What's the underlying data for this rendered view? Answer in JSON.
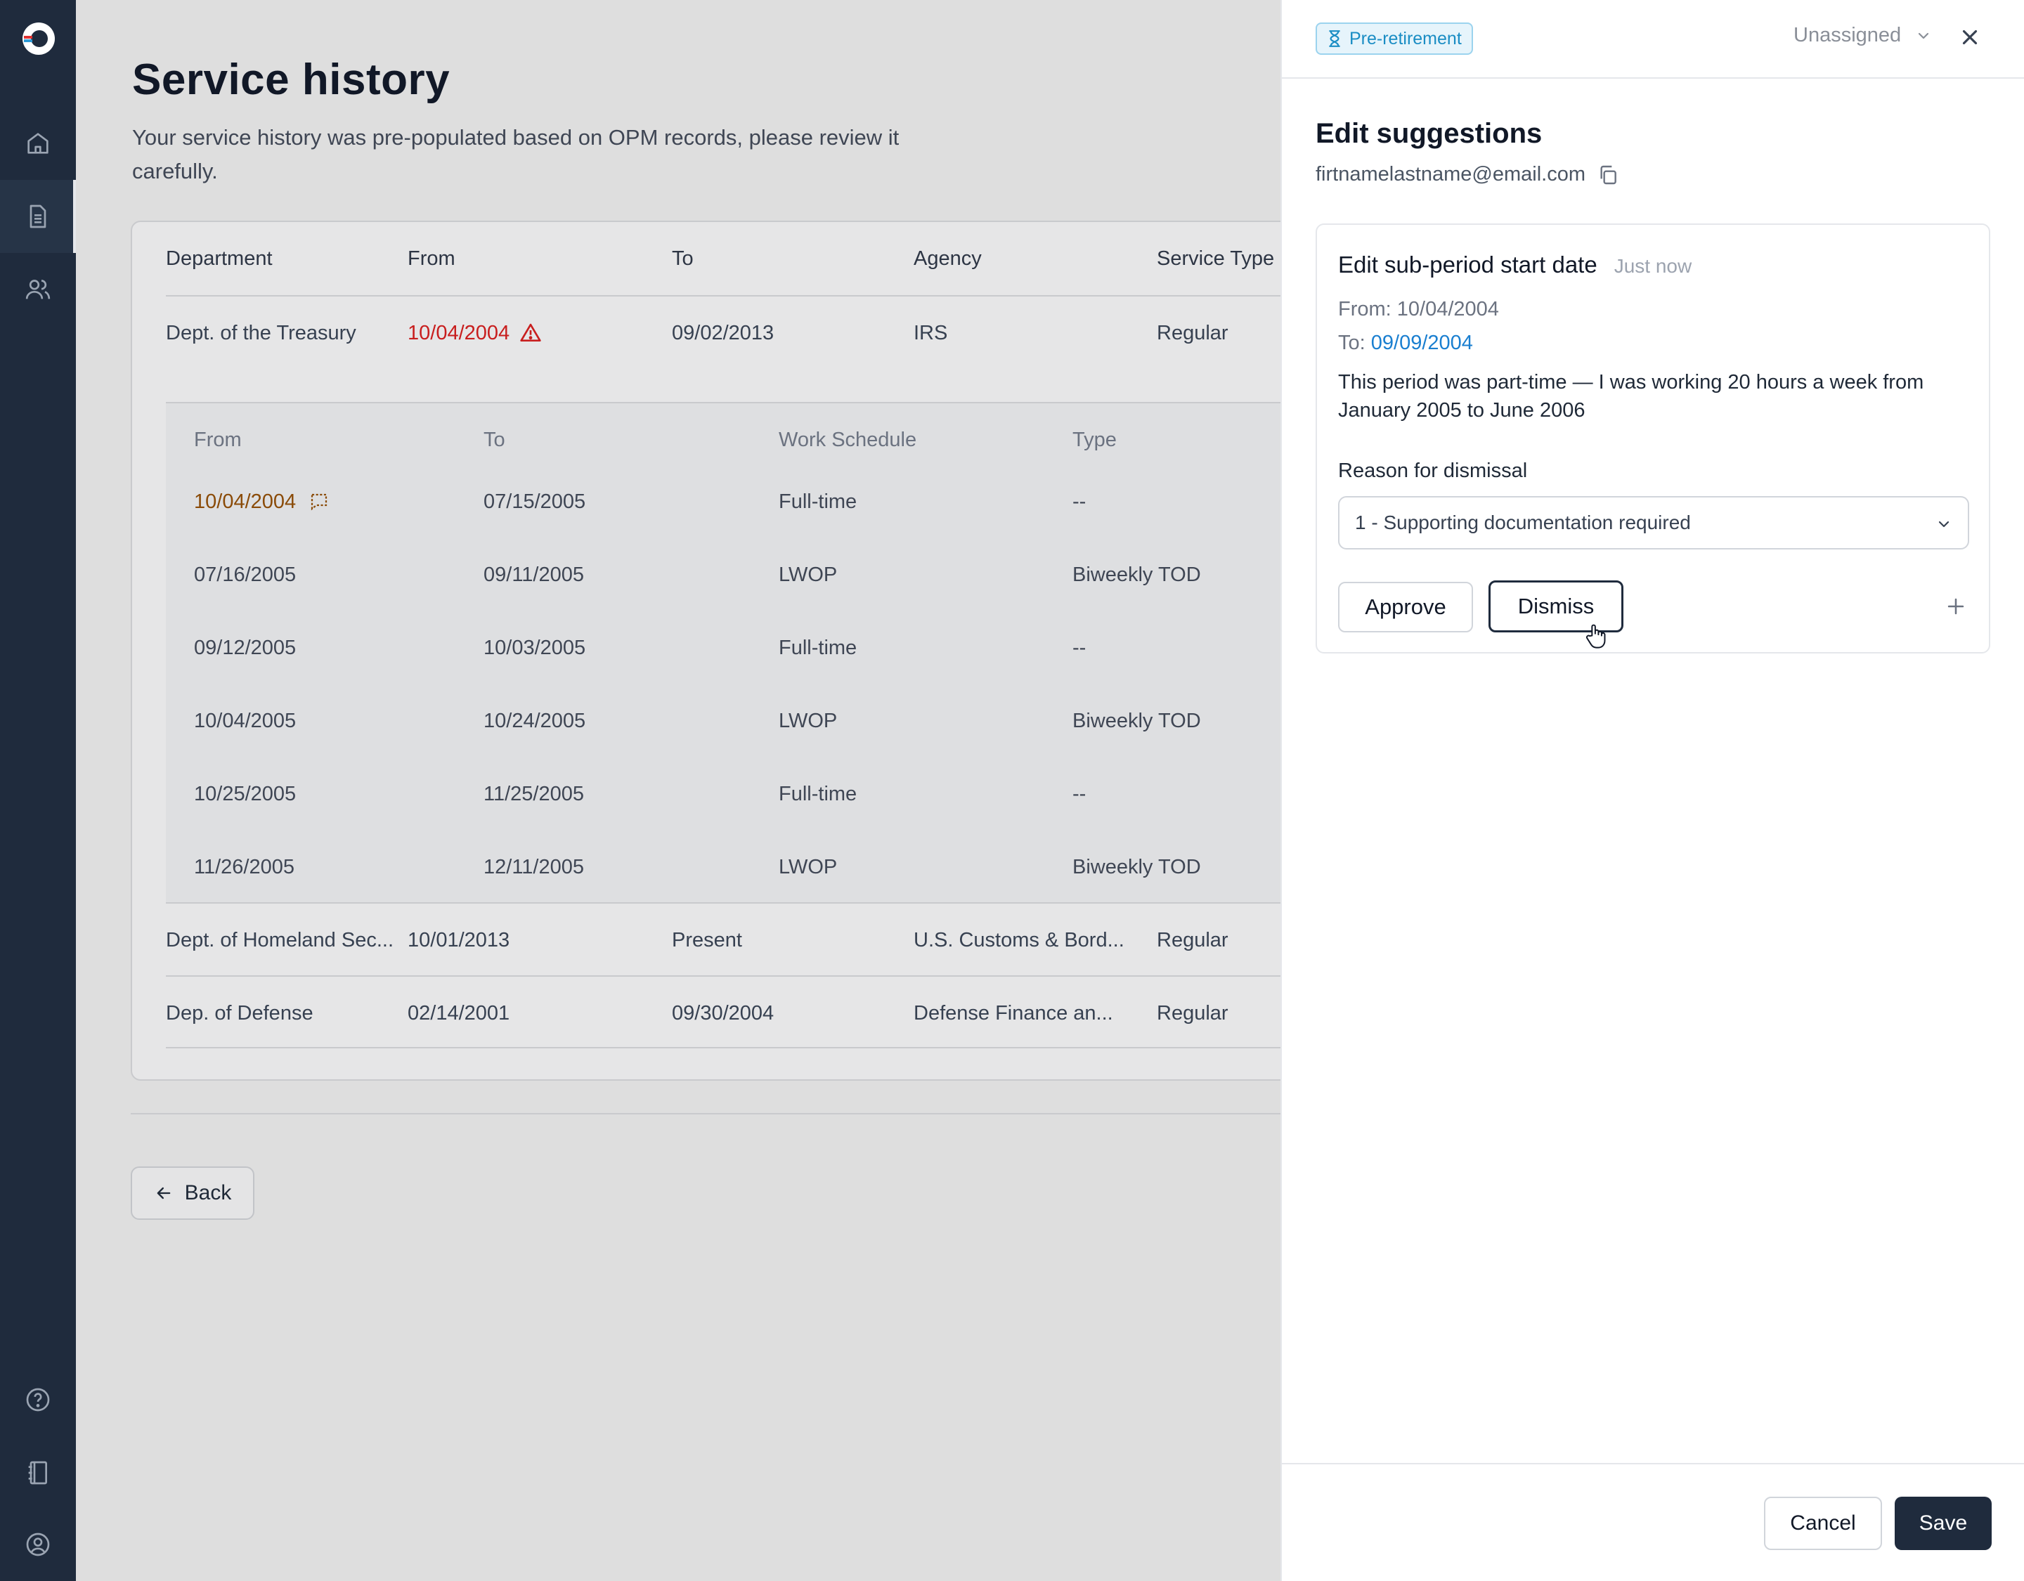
{
  "colors": {
    "sidebar_bg": "#1f2b3d",
    "error_red": "#c81e1e",
    "link_blue": "#1a7fd0",
    "badge_blue": "#1a8dc4",
    "primary_dark": "#1f2b3d",
    "highlight_amber": "#8a4b08"
  },
  "sidebar": {
    "logo": "app-logo",
    "nav": [
      {
        "icon": "home-icon"
      },
      {
        "icon": "document-icon",
        "active": true
      },
      {
        "icon": "users-icon"
      }
    ],
    "bottom": [
      {
        "icon": "help-icon"
      },
      {
        "icon": "notebook-icon"
      },
      {
        "icon": "account-icon"
      }
    ]
  },
  "page": {
    "title": "Service history",
    "subtitle": "Your service history was pre-populated based on OPM records, please review it carefully."
  },
  "table": {
    "headers": [
      "Department",
      "From",
      "To",
      "Agency",
      "Service Type"
    ],
    "rows": [
      {
        "department": "Dept. of the Treasury",
        "from": "10/04/2004",
        "to": "09/02/2013",
        "agency": "IRS",
        "service_type": "Regular",
        "from_error": true
      },
      {
        "department": "Dept. of Homeland Sec...",
        "from": "10/01/2013",
        "to": "Present",
        "agency": "U.S. Customs & Bord...",
        "service_type": "Regular"
      },
      {
        "department": "Dep. of Defense",
        "from": "02/14/2001",
        "to": "09/30/2004",
        "agency": "Defense Finance an...",
        "service_type": "Regular"
      }
    ],
    "subtable": {
      "headers": [
        "From",
        "To",
        "Work Schedule",
        "Type"
      ],
      "rows": [
        {
          "from": "10/04/2004",
          "to": "07/15/2005",
          "schedule": "Full-time",
          "type": "--",
          "has_comment": true
        },
        {
          "from": "07/16/2005",
          "to": "09/11/2005",
          "schedule": "LWOP",
          "type": "Biweekly TOD"
        },
        {
          "from": "09/12/2005",
          "to": "10/03/2005",
          "schedule": "Full-time",
          "type": "--"
        },
        {
          "from": "10/04/2005",
          "to": "10/24/2005",
          "schedule": "LWOP",
          "type": "Biweekly TOD"
        },
        {
          "from": "10/25/2005",
          "to": "11/25/2005",
          "schedule": "Full-time",
          "type": "--"
        },
        {
          "from": "11/26/2005",
          "to": "12/11/2005",
          "schedule": "LWOP",
          "type": "Biweekly TOD"
        }
      ]
    }
  },
  "back_button": {
    "label": "Back"
  },
  "panel": {
    "badge": "Pre-retirement",
    "assignee": "Unassigned",
    "title": "Edit suggestions",
    "email": "firtnamelastname@email.com",
    "suggestion": {
      "title": "Edit sub-period start date",
      "time": "Just now",
      "from_label": "From:",
      "from_value": "10/04/2004",
      "to_label": "To:",
      "to_value": "09/09/2004",
      "note": "This period was part-time — I was working 20 hours a week from January 2005 to June 2006",
      "reason_label": "Reason for dismissal",
      "reason_selected": "1 - Supporting documentation required",
      "approve_label": "Approve",
      "dismiss_label": "Dismiss"
    },
    "cancel_label": "Cancel",
    "save_label": "Save"
  }
}
